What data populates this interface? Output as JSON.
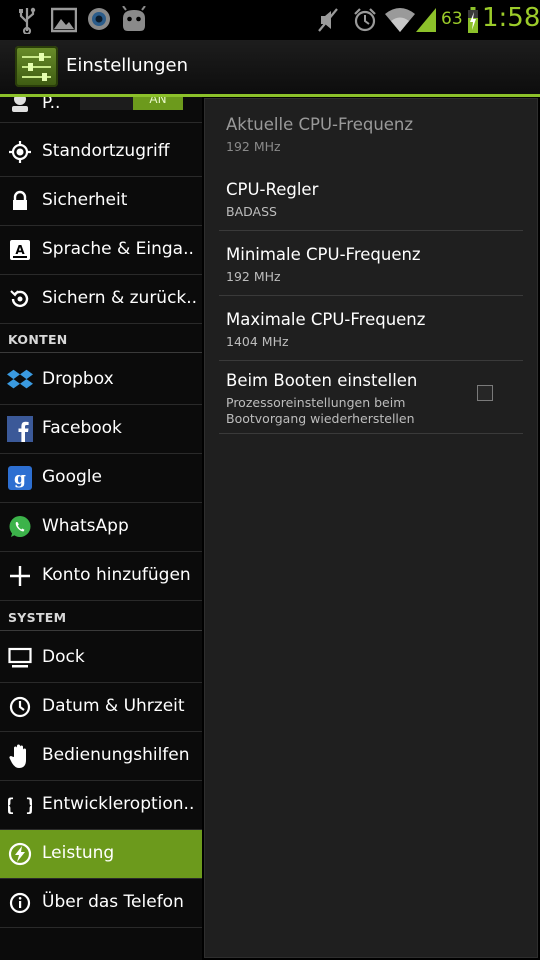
{
  "status_bar": {
    "battery_percent": "63",
    "clock": "1:58",
    "icons_left": [
      "usb-icon",
      "image-icon",
      "camera-icon",
      "android-icon"
    ],
    "icons_right": [
      "mute-icon",
      "alarm-icon",
      "wifi-icon",
      "signal-icon",
      "battery-charging-icon"
    ]
  },
  "action_bar": {
    "title": "Einstellungen",
    "icon": "settings-sliders-icon"
  },
  "left_pane": {
    "top_item": {
      "label": "P..",
      "toggle": "AN",
      "icon": "person-icon"
    },
    "items_personal": [
      {
        "label": "Standortzugriff",
        "icon": "location-icon"
      },
      {
        "label": "Sicherheit",
        "icon": "lock-icon"
      },
      {
        "label": "Sprache & Einga..",
        "icon": "keyboard-icon"
      },
      {
        "label": "Sichern & zurück..",
        "icon": "backup-icon"
      }
    ],
    "section_accounts": "KONTEN",
    "items_accounts": [
      {
        "label": "Dropbox",
        "icon": "dropbox-icon"
      },
      {
        "label": "Facebook",
        "icon": "facebook-icon"
      },
      {
        "label": "Google",
        "icon": "google-icon"
      },
      {
        "label": "WhatsApp",
        "icon": "whatsapp-icon"
      },
      {
        "label": "Konto hinzufügen",
        "icon": "plus-icon"
      }
    ],
    "section_system": "SYSTEM",
    "items_system": [
      {
        "label": "Dock",
        "icon": "monitor-icon"
      },
      {
        "label": "Datum & Uhrzeit",
        "icon": "clock-icon"
      },
      {
        "label": "Bedienungshilfen",
        "icon": "hand-icon"
      },
      {
        "label": "Entwickleroption..",
        "icon": "braces-icon"
      },
      {
        "label": "Leistung",
        "icon": "power-bolt-icon",
        "selected": true
      },
      {
        "label": "Über das Telefon",
        "icon": "info-icon"
      }
    ]
  },
  "right_pane": {
    "prefs": [
      {
        "title": "Aktuelle CPU-Frequenz",
        "summary": "192 MHz",
        "enabled": false
      },
      {
        "title": "CPU-Regler",
        "summary": "BADASS",
        "enabled": true
      },
      {
        "title": "Minimale CPU-Frequenz",
        "summary": "192 MHz",
        "enabled": true
      },
      {
        "title": "Maximale CPU-Frequenz",
        "summary": "1404 MHz",
        "enabled": true
      }
    ],
    "boot_pref": {
      "title": "Beim Booten einstellen",
      "summary_line1": "Prozessoreinstellungen beim",
      "summary_line2": "Bootvorgang wiederherstellen",
      "checked": false
    }
  },
  "colors": {
    "accent": "#8cc12a",
    "selected_row": "#6c9a1c",
    "panel_bg": "#1f1f1f"
  }
}
